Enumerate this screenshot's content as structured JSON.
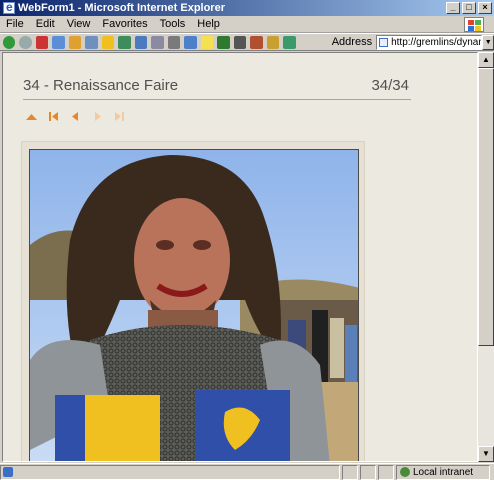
{
  "window": {
    "title": "WebForm1 - Microsoft Internet Explorer",
    "buttons": [
      "_",
      "□",
      "×"
    ]
  },
  "menu": {
    "items": [
      "File",
      "Edit",
      "View",
      "Favorites",
      "Tools",
      "Help"
    ]
  },
  "toolbar": {
    "address_label": "Address",
    "address_value": "http://gremlins/dynamicth"
  },
  "gallery": {
    "title": "34 - Renaissance Faire",
    "counter": "34/34",
    "accent_color": "#e8862a",
    "nav": [
      "collapse-up",
      "first",
      "previous",
      "next",
      "last"
    ],
    "photo_alt": "Knight in chainmail at a Renaissance Faire"
  },
  "status": {
    "zone": "Local intranet"
  }
}
